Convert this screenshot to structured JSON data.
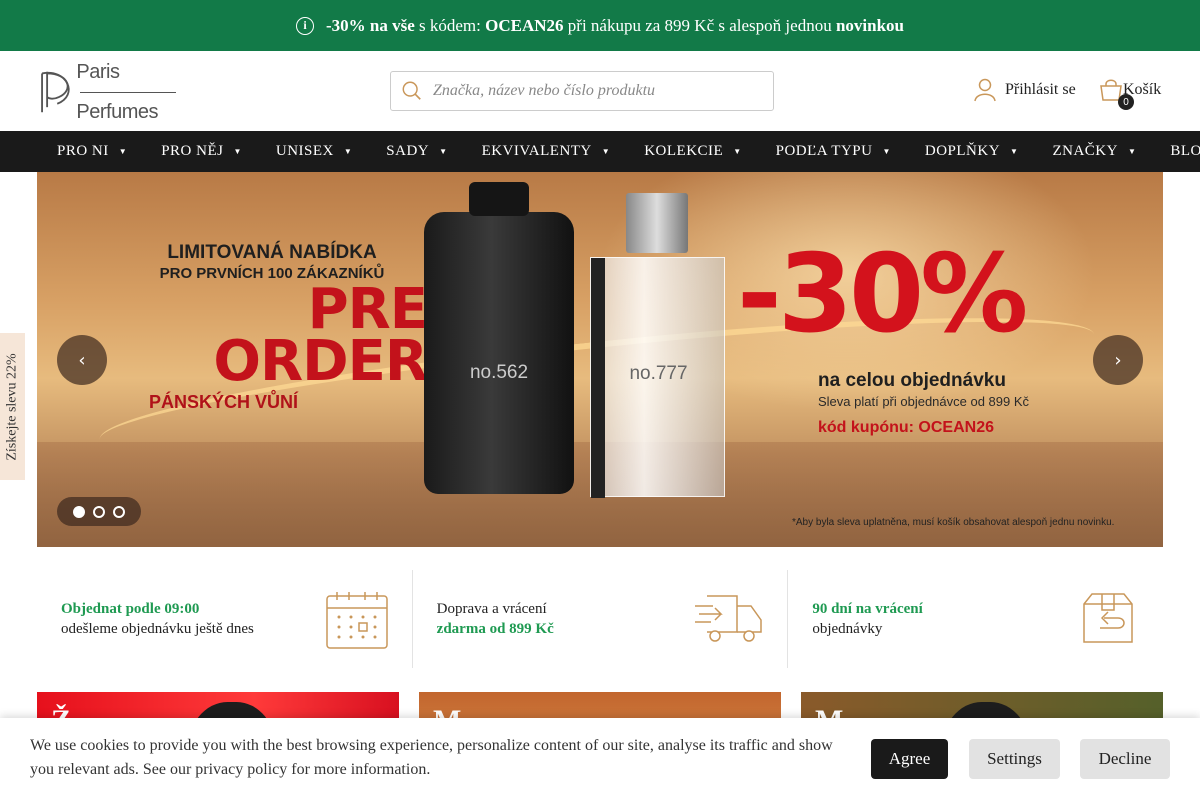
{
  "topbar": {
    "discount": "-30% na vše",
    "text1": " s kódem: ",
    "code": "OCEAN26",
    "text2": " při nákupu za 899 Kč s alespoň jednou ",
    "novinkou": "novinkou"
  },
  "header": {
    "logo_line1": "Paris",
    "logo_line2": "Perfumes",
    "search_placeholder": "Značka, název nebo číslo produktu",
    "login": "Přihlásit se",
    "cart_label": "Košík",
    "cart_count": "0"
  },
  "nav": {
    "items": [
      {
        "label": "PRO NI",
        "dropdown": true
      },
      {
        "label": "PRO NĚJ",
        "dropdown": true
      },
      {
        "label": "UNISEX",
        "dropdown": true
      },
      {
        "label": "SADY",
        "dropdown": true
      },
      {
        "label": "EKVIVALENTY",
        "dropdown": true
      },
      {
        "label": "KOLEKCIE",
        "dropdown": true
      },
      {
        "label": "PODĽA TYPU",
        "dropdown": true
      },
      {
        "label": "DOPLŇKY",
        "dropdown": true
      },
      {
        "label": "ZNAČKY",
        "dropdown": true
      },
      {
        "label": "BLOG",
        "dropdown": false
      }
    ]
  },
  "banner": {
    "limit_line1": "LIMITOVANÁ NABÍDKA",
    "limit_line2": "PRO PRVNÍCH 100 ZÁKAZNÍKŮ",
    "pre": "PRE",
    "order": "ORDER",
    "panskych": "PÁNSKÝCH VŮNÍ",
    "bottle1": "no.562",
    "bottle2": "no.777",
    "percent": "-30%",
    "celou": "na celou objednávku",
    "sleva": "Sleva platí při objednávce od 899 Kč",
    "kod": "kód kupónu: OCEAN26",
    "note": "*Aby byla sleva uplatněna, musí košík obsahovat alespoň jednu novinku.",
    "slides": 3,
    "active_slide": 1
  },
  "sidetab": "Získejte slevu 22%",
  "features": [
    {
      "green": "Objednat podle 09:00",
      "text": "odešleme objednávku ještě dnes",
      "icon": "calendar-icon"
    },
    {
      "text": "Doprava a vrácení",
      "green": "zdarma od 899 Kč",
      "icon": "delivery-truck-icon"
    },
    {
      "green": "90 dní na vrácení",
      "text": "objednávky",
      "icon": "return-box-icon"
    }
  ],
  "cards": [
    {
      "title": "Ž"
    },
    {
      "title": "M"
    },
    {
      "title": "M"
    }
  ],
  "cookie": {
    "text": "We use cookies to provide you with the best browsing experience, personalize content of our site, analyse its traffic and show you relevant ads. See our privacy policy for more information.",
    "agree": "Agree",
    "settings": "Settings",
    "decline": "Decline"
  },
  "colors": {
    "topbar": "#127a48",
    "nav": "#1a1a1a",
    "accent_green": "#1f9a52",
    "icon_gold": "#c9975a"
  }
}
